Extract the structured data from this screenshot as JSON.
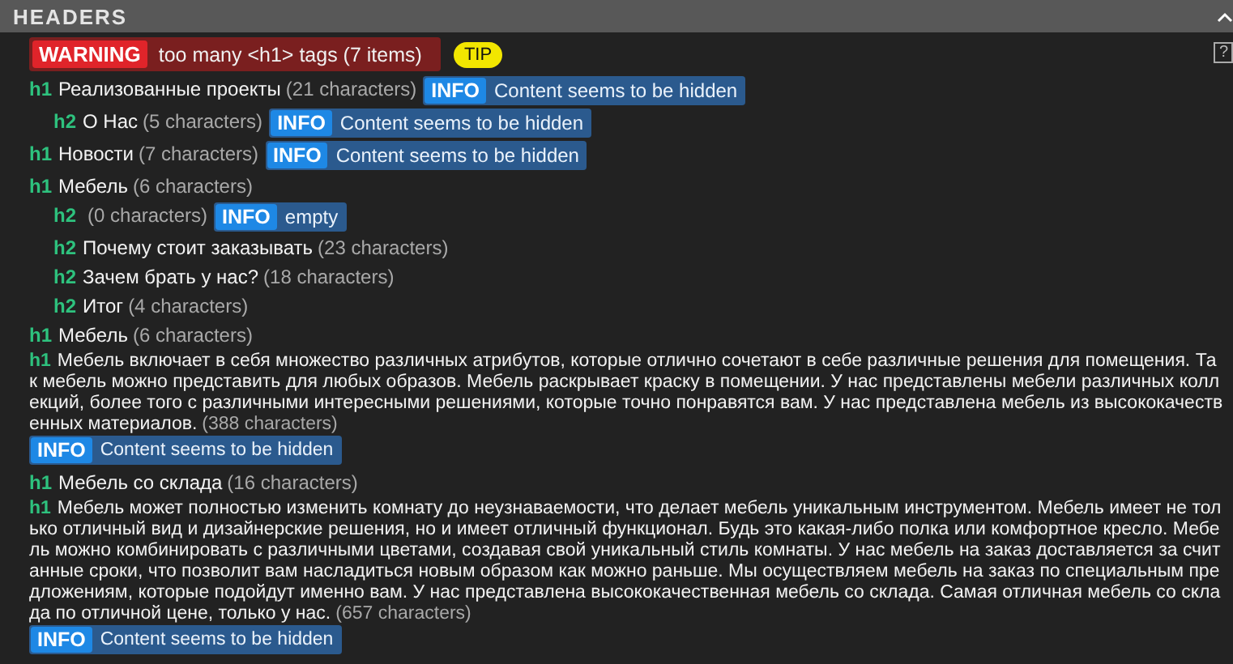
{
  "panel": {
    "title": "HEADERS",
    "help": "?"
  },
  "warning": {
    "label": "WARNING",
    "message": "too many <h1> tags (7 items)",
    "tip": "TIP"
  },
  "headers": [
    {
      "tag": "h1",
      "text": "Реализованные проекты",
      "count": "(21 characters)",
      "info": {
        "label": "INFO",
        "message": "Content seems to be hidden"
      },
      "children": [
        {
          "tag": "h2",
          "text": "О Нас",
          "count": "(5 characters)",
          "info": {
            "label": "INFO",
            "message": "Content seems to be hidden"
          }
        }
      ]
    },
    {
      "tag": "h1",
      "text": "Новости",
      "count": "(7 characters)",
      "info": {
        "label": "INFO",
        "message": "Content seems to be hidden"
      }
    },
    {
      "tag": "h1",
      "text": "Мебель",
      "count": "(6 characters)",
      "children": [
        {
          "tag": "h2",
          "count": "(0 characters)",
          "info": {
            "label": "INFO",
            "message": "empty"
          }
        },
        {
          "tag": "h2",
          "text": "Почему стоит заказывать",
          "count": "(23 characters)"
        },
        {
          "tag": "h2",
          "text": "Зачем брать у нас?",
          "count": "(18 characters)"
        },
        {
          "tag": "h2",
          "text": "Итог",
          "count": "(4 characters)"
        }
      ]
    },
    {
      "tag": "h1",
      "text": "Мебель",
      "count": "(6 characters)"
    },
    {
      "tag": "h1",
      "text": "Мебель включает в себя множество различных атрибутов, которые отлично сочетают в себе различные решения для помещения. Так мебель можно представить для любых образов. Мебель раскрывает краску в помещении. У нас представлены мебели различных коллекций, более того с различными интересными решениями, которые точно понравятся вам. У нас представлена мебель из высококачественных материалов.",
      "count": "(388 characters)",
      "info": {
        "label": "INFO",
        "message": "Content seems to be hidden"
      }
    },
    {
      "tag": "h1",
      "text": "Мебель со склада",
      "count": "(16 characters)"
    },
    {
      "tag": "h1",
      "text": "Мебель может полностью изменить комнату до неузнаваемости, что делает мебель уникальным инструментом. Мебель имеет не только отличный вид и дизайнерские решения, но и имеет отличный функционал. Будь это какая-либо полка или комфортное кресло. Мебель можно комбинировать с различными цветами, создавая свой уникальный стиль комнаты. У нас мебель на заказ доставляется за считанные сроки, что позволит вам насладиться новым образом как можно раньше. Мы осуществляем мебель на заказ по специальным предложениям, которые подойдут именно вам. У нас представлена высококачественная мебель со склада. Самая отличная мебель со склада по отличной цене, только у нас.",
      "count": "(657 characters)",
      "info": {
        "label": "INFO",
        "message": "Content seems to be hidden"
      }
    }
  ]
}
